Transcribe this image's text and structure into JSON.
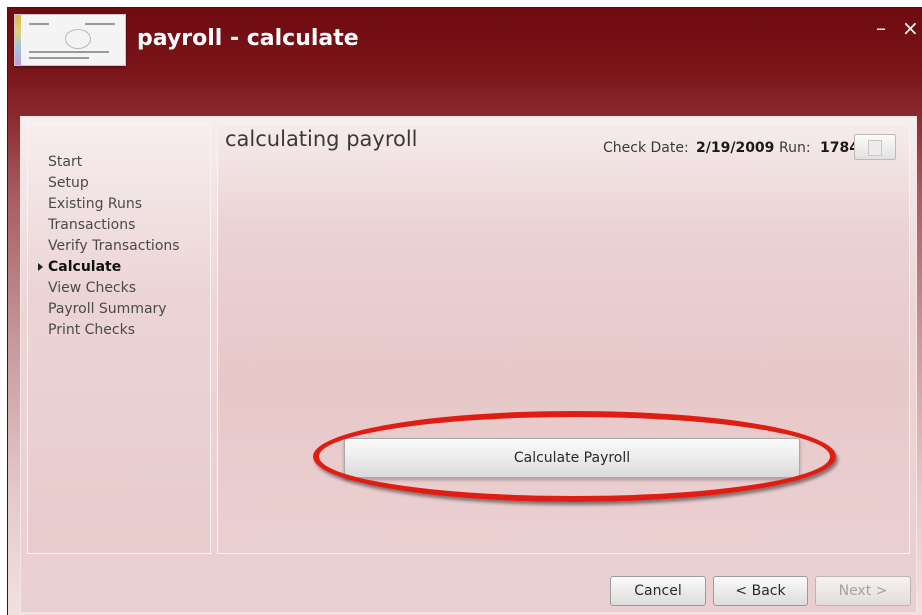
{
  "window": {
    "title": "payroll - calculate",
    "minimize_label": "–",
    "close_label": "×"
  },
  "nav": {
    "items": [
      {
        "label": "Start",
        "active": false
      },
      {
        "label": "Setup",
        "active": false
      },
      {
        "label": "Existing Runs",
        "active": false
      },
      {
        "label": "Transactions",
        "active": false
      },
      {
        "label": "Verify Transactions",
        "active": false
      },
      {
        "label": "Calculate",
        "active": true
      },
      {
        "label": "View Checks",
        "active": false
      },
      {
        "label": "Payroll Summary",
        "active": false
      },
      {
        "label": "Print Checks",
        "active": false
      }
    ]
  },
  "main": {
    "title": "calculating payroll",
    "check_date_label": "Check Date:",
    "check_date_value": "2/19/2009",
    "run_label": "Run:",
    "run_value": "1784",
    "calculate_button_label": "Calculate Payroll"
  },
  "footer": {
    "cancel_label": "Cancel",
    "back_label": "< Back",
    "next_label": "Next >"
  },
  "colors": {
    "title_bar": "#6e0b10",
    "highlight_ring": "#e01d12"
  },
  "icons": {
    "app": "payroll-check-icon",
    "print": "print-icon"
  }
}
